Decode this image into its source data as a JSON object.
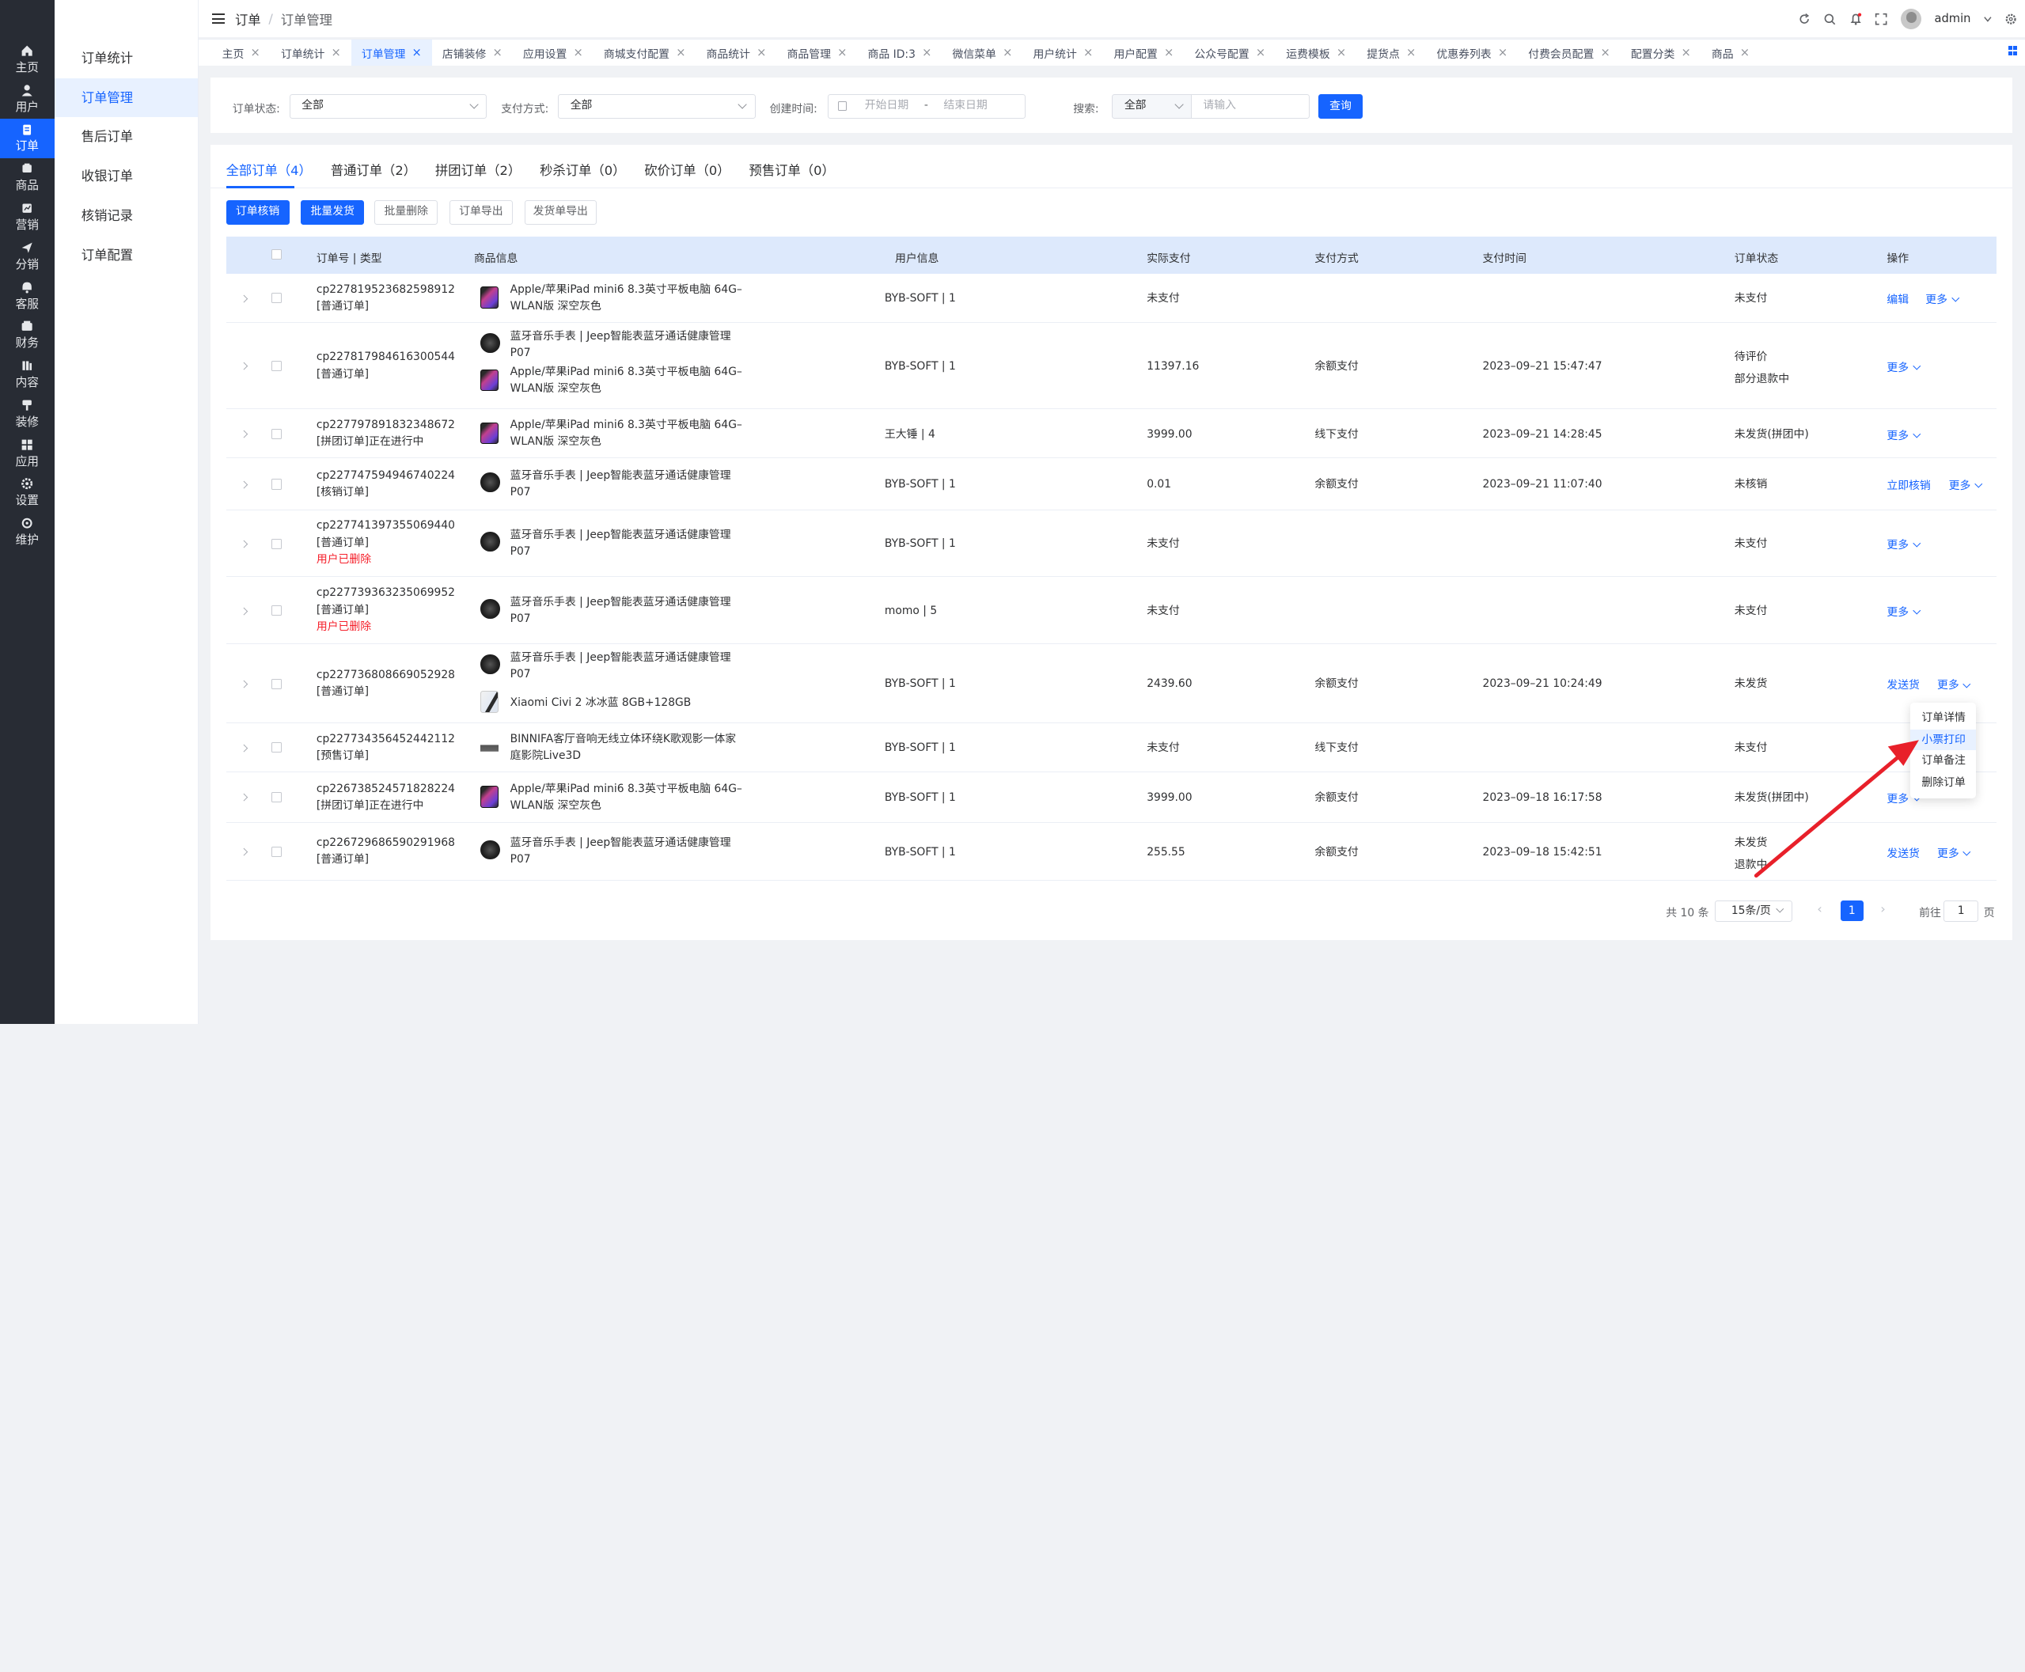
{
  "rail": [
    {
      "label": "主页",
      "icon": "home-icon"
    },
    {
      "label": "用户",
      "icon": "user-icon"
    },
    {
      "label": "订单",
      "icon": "order-icon",
      "active": true
    },
    {
      "label": "商品",
      "icon": "product-icon"
    },
    {
      "label": "营销",
      "icon": "marketing-icon"
    },
    {
      "label": "分销",
      "icon": "distribution-icon"
    },
    {
      "label": "客服",
      "icon": "service-icon"
    },
    {
      "label": "财务",
      "icon": "finance-icon"
    },
    {
      "label": "内容",
      "icon": "content-icon"
    },
    {
      "label": "装修",
      "icon": "decoration-icon"
    },
    {
      "label": "应用",
      "icon": "apps-icon"
    },
    {
      "label": "设置",
      "icon": "settings-icon"
    },
    {
      "label": "维护",
      "icon": "maintenance-icon"
    }
  ],
  "submenu": [
    "订单统计",
    "订单管理",
    "售后订单",
    "收银订单",
    "核销记录",
    "订单配置"
  ],
  "breadcrumb": {
    "root": "订单",
    "sep": "/",
    "current": "订单管理"
  },
  "user": {
    "name": "admin"
  },
  "tabs": [
    "主页",
    "订单统计",
    "订单管理",
    "店铺装修",
    "应用设置",
    "商城支付配置",
    "商品统计",
    "商品管理",
    "商品 ID:3",
    "微信菜单",
    "用户统计",
    "用户配置",
    "公众号配置",
    "运费模板",
    "提货点",
    "优惠券列表",
    "付费会员配置",
    "配置分类",
    "商品"
  ],
  "filter": {
    "status_label": "订单状态:",
    "status_value": "全部",
    "pay_label": "支付方式:",
    "pay_value": "全部",
    "time_label": "创建时间:",
    "start_placeholder": "开始日期",
    "range_sep": "-",
    "end_placeholder": "结束日期",
    "search_label": "搜索:",
    "search_scope": "全部",
    "search_placeholder": "请输入",
    "query_button": "查询"
  },
  "order_tabs": [
    "全部订单（4）",
    "普通订单（2）",
    "拼团订单（2）",
    "秒杀订单（0）",
    "砍价订单（0）",
    "预售订单（0）"
  ],
  "actions": [
    "订单核销",
    "批量发货",
    "批量删除",
    "订单导出",
    "发货单导出"
  ],
  "columns": [
    "订单号 | 类型",
    "商品信息",
    "用户信息",
    "实际支付",
    "支付方式",
    "支付时间",
    "订单状态",
    "操作"
  ],
  "rows": [
    {
      "no": "cp227819523682598912",
      "type": "[普通订单]",
      "products": [
        {
          "img": "ipad",
          "name1": "Apple/苹果iPad mini6 8.3英寸平板电脑 64G–",
          "name2": "WLAN版 深空灰色"
        }
      ],
      "user": "BYB-SOFT | 1",
      "paid": "未支付",
      "pay_method": "",
      "pay_time": "",
      "status": [
        "未支付"
      ],
      "ops": [
        "编辑",
        "更多"
      ]
    },
    {
      "no": "cp227817984616300544",
      "type": "[普通订单]",
      "products": [
        {
          "img": "watch",
          "name1": "蓝牙音乐手表 | Jeep智能表蓝牙通话健康管理",
          "name2": "P07"
        },
        {
          "img": "ipad",
          "name1": "Apple/苹果iPad mini6 8.3英寸平板电脑 64G–",
          "name2": "WLAN版 深空灰色"
        }
      ],
      "user": "BYB-SOFT | 1",
      "paid": "11397.16",
      "pay_method": "余额支付",
      "pay_time": "2023–09–21 15:47:47",
      "status": [
        "待评价",
        "部分退款中"
      ],
      "ops": [
        "更多"
      ]
    },
    {
      "no": "cp227797891832348672",
      "type": "[拼团订单]正在进行中",
      "products": [
        {
          "img": "ipad",
          "name1": "Apple/苹果iPad mini6 8.3英寸平板电脑 64G–",
          "name2": "WLAN版 深空灰色"
        }
      ],
      "user": "王大锤 | 4",
      "paid": "3999.00",
      "pay_method": "线下支付",
      "pay_time": "2023–09–21 14:28:45",
      "status": [
        "未发货(拼团中)"
      ],
      "ops": [
        "更多"
      ]
    },
    {
      "no": "cp227747594946740224",
      "type": "[核销订单]",
      "products": [
        {
          "img": "watch",
          "name1": "蓝牙音乐手表 | Jeep智能表蓝牙通话健康管理",
          "name2": "P07"
        }
      ],
      "user": "BYB-SOFT | 1",
      "paid": "0.01",
      "pay_method": "余额支付",
      "pay_time": "2023–09–21 11:07:40",
      "status": [
        "未核销"
      ],
      "ops": [
        "立即核销",
        "更多"
      ]
    },
    {
      "no": "cp227741397355069440",
      "type": "[普通订单]",
      "deleted": "用户已删除",
      "products": [
        {
          "img": "watch",
          "name1": "蓝牙音乐手表 | Jeep智能表蓝牙通话健康管理",
          "name2": "P07"
        }
      ],
      "user": "BYB-SOFT | 1",
      "paid": "未支付",
      "pay_method": "",
      "pay_time": "",
      "status": [
        "未支付"
      ],
      "ops": [
        "更多"
      ]
    },
    {
      "no": "cp227739363235069952",
      "type": "[普通订单]",
      "deleted": "用户已删除",
      "products": [
        {
          "img": "watch",
          "name1": "蓝牙音乐手表 | Jeep智能表蓝牙通话健康管理",
          "name2": "P07"
        }
      ],
      "user": "momo | 5",
      "paid": "未支付",
      "pay_method": "",
      "pay_time": "",
      "status": [
        "未支付"
      ],
      "ops": [
        "更多"
      ]
    },
    {
      "no": "cp227736808669052928",
      "type": "[普通订单]",
      "products": [
        {
          "img": "watch",
          "name1": "蓝牙音乐手表 | Jeep智能表蓝牙通话健康管理",
          "name2": "P07"
        },
        {
          "img": "phone",
          "name1": "Xiaomi Civi 2 冰冰蓝 8GB+128GB",
          "name2": ""
        }
      ],
      "user": "BYB-SOFT | 1",
      "paid": "2439.60",
      "pay_method": "余额支付",
      "pay_time": "2023–09–21 10:24:49",
      "status": [
        "未发货"
      ],
      "ops": [
        "发送货",
        "更多"
      ]
    },
    {
      "no": "cp227734356452442112",
      "type": "[预售订单]",
      "products": [
        {
          "img": "speaker",
          "name1": "BINNIFA客厅音响无线立体环绕K歌观影一体家",
          "name2": "庭影院Live3D"
        }
      ],
      "user": "BYB-SOFT | 1",
      "paid": "未支付",
      "pay_method": "线下支付",
      "pay_time": "",
      "status": [
        "未支付"
      ],
      "ops": []
    },
    {
      "no": "cp226738524571828224",
      "type": "[拼团订单]正在进行中",
      "products": [
        {
          "img": "ipad",
          "name1": "Apple/苹果iPad mini6 8.3英寸平板电脑 64G–",
          "name2": "WLAN版 深空灰色"
        }
      ],
      "user": "BYB-SOFT | 1",
      "paid": "3999.00",
      "pay_method": "余额支付",
      "pay_time": "2023–09–18 16:17:58",
      "status": [
        "未发货(拼团中)"
      ],
      "ops": [
        "更多"
      ]
    },
    {
      "no": "cp226729686590291968",
      "type": "[普通订单]",
      "products": [
        {
          "img": "watch",
          "name1": "蓝牙音乐手表 | Jeep智能表蓝牙通话健康管理",
          "name2": "P07"
        }
      ],
      "user": "BYB-SOFT | 1",
      "paid": "255.55",
      "pay_method": "余额支付",
      "pay_time": "2023–09–18 15:42:51",
      "status": [
        "未发货",
        "退款中"
      ],
      "ops": [
        "发送货",
        "更多"
      ]
    }
  ],
  "dropdown": [
    "订单详情",
    "小票打印",
    "订单备注",
    "删除订单"
  ],
  "pagination": {
    "total": "共 10 条",
    "page_size": "15条/页",
    "current": "1",
    "goto_label": "前往",
    "goto_value": "1",
    "page_suffix": "页"
  },
  "colors": {
    "primary": "#1664ff",
    "sidebar": "#282c34",
    "danger": "#f5222d",
    "annotation": "#e8202a"
  }
}
